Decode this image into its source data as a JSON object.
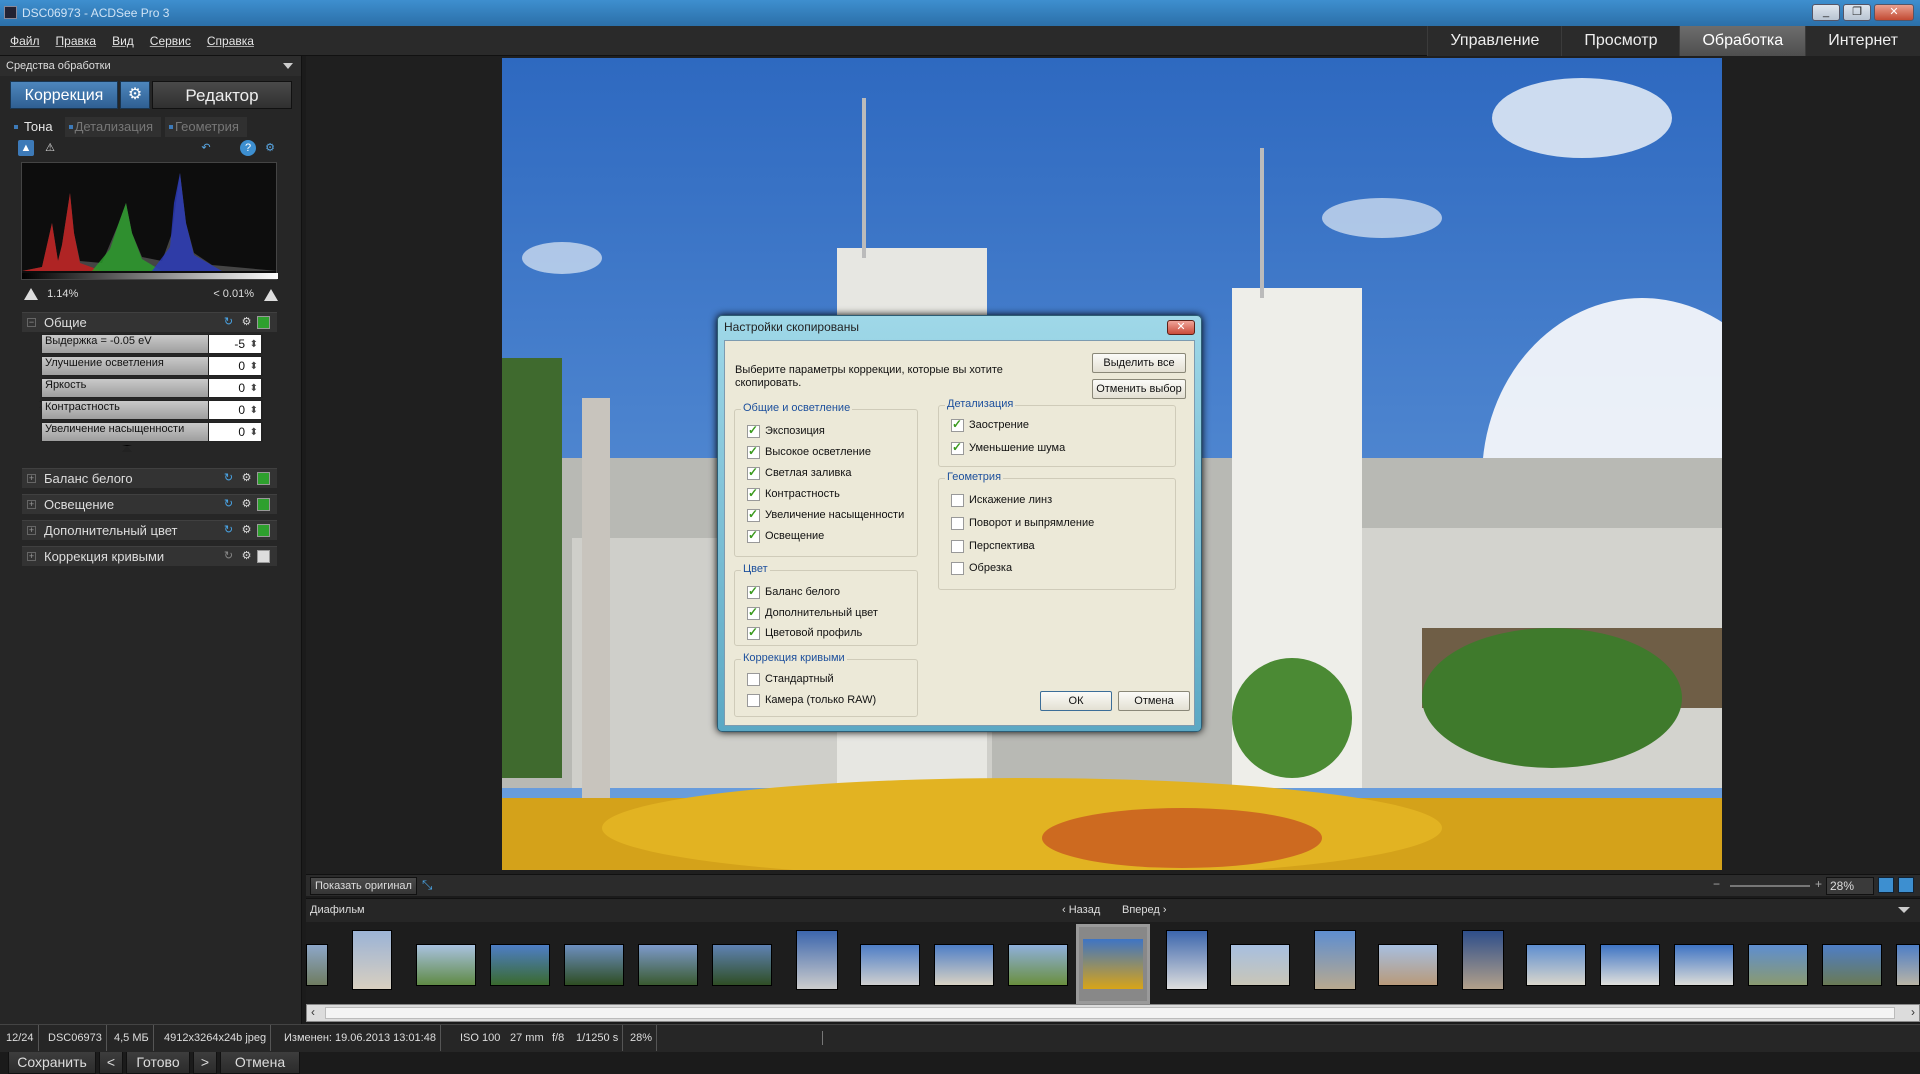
{
  "window": {
    "title": "DSC06973 - ACDSee Pro 3",
    "buttons": [
      "_",
      "❐",
      "✕"
    ]
  },
  "menu": [
    "Файл",
    "Правка",
    "Вид",
    "Сервис",
    "Справка"
  ],
  "modes": [
    {
      "label": "Управление"
    },
    {
      "label": "Просмотр"
    },
    {
      "label": "Обработка",
      "active": true
    },
    {
      "label": "Интернет"
    }
  ],
  "left_panel": {
    "header": "Средства обработки",
    "tab_correction": "Коррекция",
    "tab_editor": "Редактор",
    "subtabs": [
      "Тона",
      "Детализация",
      "Геометрия"
    ],
    "clip_low": "1.14%",
    "clip_high": "< 0.01%",
    "general": {
      "label": "Общие",
      "sliders": [
        {
          "label": "Выдержка = -0.05 eV",
          "value": "-5"
        },
        {
          "label": "Улучшение осветления",
          "value": "0"
        },
        {
          "label": "Яркость",
          "value": "0"
        },
        {
          "label": "Контрастность",
          "value": "0"
        },
        {
          "label": "Увеличение насыщенности",
          "value": "0"
        }
      ]
    },
    "groups": [
      "Баланс белого",
      "Освещение",
      "Дополнительный цвет",
      "Коррекция кривыми"
    ],
    "buttons": {
      "save": "Сохранить",
      "prev": "<",
      "done": "Готово",
      "next": ">",
      "cancel": "Отмена"
    }
  },
  "viewer": {
    "show_original": "Показать оригинал",
    "zoom": "28%"
  },
  "filmstrip": {
    "title": "Диафильм",
    "back": "Назад",
    "forward": "Вперед"
  },
  "status": [
    "12/24",
    "DSC06973",
    "4,5 МБ",
    "4912x3264x24b jpeg",
    "Изменен: 19.06.2013 13:01:48",
    "ISO 100",
    "27 mm",
    "f/8",
    "1/1250 s",
    "28%"
  ],
  "dialog": {
    "title": "Настройки скопированы",
    "close": "✕",
    "prompt": "Выберите параметры коррекции, которые вы хотите скопировать.",
    "select_all": "Выделить все",
    "deselect": "Отменить выбор",
    "ok": "ОК",
    "cancel": "Отмена",
    "sections": {
      "general": {
        "title": "Общие и осветление",
        "items": [
          "Экспозиция",
          "Высокое осветление",
          "Светлая заливка",
          "Контрастность",
          "Увеличение насыщенности",
          "Освещение"
        ]
      },
      "color": {
        "title": "Цвет",
        "items": [
          "Баланс белого",
          "Дополнительный цвет",
          "Цветовой профиль"
        ]
      },
      "curves": {
        "title": "Коррекция кривыми",
        "items": [
          "Стандартный",
          "Камера (только RAW)"
        ]
      },
      "detail": {
        "title": "Детализация",
        "items": [
          "Заострение",
          "Уменьшение шума"
        ]
      },
      "geometry": {
        "title": "Геометрия",
        "items": [
          "Искажение линз",
          "Поворот и выпрямление",
          "Перспектива",
          "Обрезка"
        ]
      }
    }
  },
  "colors": {
    "accent": "#3d7ab8",
    "dialog_bg": "#ece9d8",
    "check": "#3b9a1e"
  }
}
